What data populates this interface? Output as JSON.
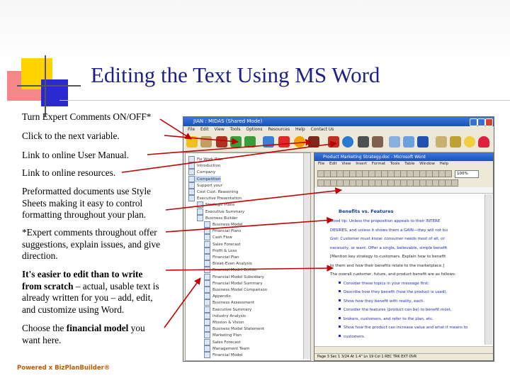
{
  "title": "Editing the Text Using MS Word",
  "notes": [
    {
      "text": "Turn Expert Comments ON/OFF*"
    },
    {
      "text": "Click to the next variable."
    },
    {
      "text": "Link to online User Manual."
    },
    {
      "text": "Link to online resources."
    },
    {
      "text": "Preformatted documents use Style Sheets making it easy to control formatting throughout your plan."
    },
    {
      "text": "*Expert comments throughout offer suggestions, explain issues, and give direction."
    },
    {
      "bold": "It's easier to edit than to write from scratch",
      "text": " – actual, usable text is already written for you – add, edit, and customize using Word."
    },
    {
      "pre": "Choose the ",
      "bold": "financial model",
      "text": " you want here."
    }
  ],
  "footer": "Powered x BizPlanBuilder®",
  "app": {
    "title": "JIAN : MIDAS (Shared Mode)",
    "menu": [
      "File",
      "Edit",
      "View",
      "Tools",
      "Options",
      "Resources",
      "Help",
      "Contact Us"
    ],
    "tree_items": [
      "Fix Work Plan",
      "Introduction",
      "Company",
      "Competition",
      "Support your",
      "Cost Cust. Reasoning",
      "Executive Presentation",
      "Strategic Plans",
      "Executive Summary",
      "Business Builder",
      "Business Model",
      "Financial Plans",
      "Cash Flow",
      "Sales Forecast",
      "Profit & Loss",
      "Financial Plan",
      "Break-Even Analysis",
      "Financial Model Builder",
      "Financial Model Subsidiary",
      "Financial Model Summary",
      "Business Model Comparison",
      "Appendix",
      "Business Assessment",
      "Executive Summary",
      "Industry Analysis",
      "Mission & Vision",
      "Business Model Statement",
      "Marketing Plan",
      "Sales Forecast",
      "Management Team",
      "Financial Model"
    ],
    "word": {
      "title": "Product Marketing Strategy.doc - Microsoft Word",
      "menu": [
        "File",
        "Edit",
        "View",
        "Insert",
        "Format",
        "Tools",
        "Table",
        "Window",
        "Help"
      ],
      "zoom": "100%",
      "heading": "Benefits vs. Features",
      "lines": [
        "Good tip: Unless the proposition appeals to their INTERE",
        "DESIRES, and unless it shows them a GAIN—they will not bu",
        "Gist: Customer must know: consumer needs most of all, or",
        "necessity, or want. Offer a single, believable, simple benefit",
        "[Mention key strategy to customers. Explain how to benefit",
        "to them and how their benefits relate to the marketplace.]",
        "The overall customer, future, and product benefit are as follows:",
        "Consider these topics in your message first:",
        "Describe how they benefit (how the product is used).",
        "Show how they benefit with reality, each.",
        "Consider the features (product can be) to benefit most,",
        "brokers, customers, and refer to the plan, etc.",
        "Show how the product can increase value and what it means to",
        "customers."
      ],
      "status": "Page 3   Sec 1   3/24   At 1.4\"   Ln 19   Col 1   REC  TRK  EXT  OVR"
    }
  }
}
